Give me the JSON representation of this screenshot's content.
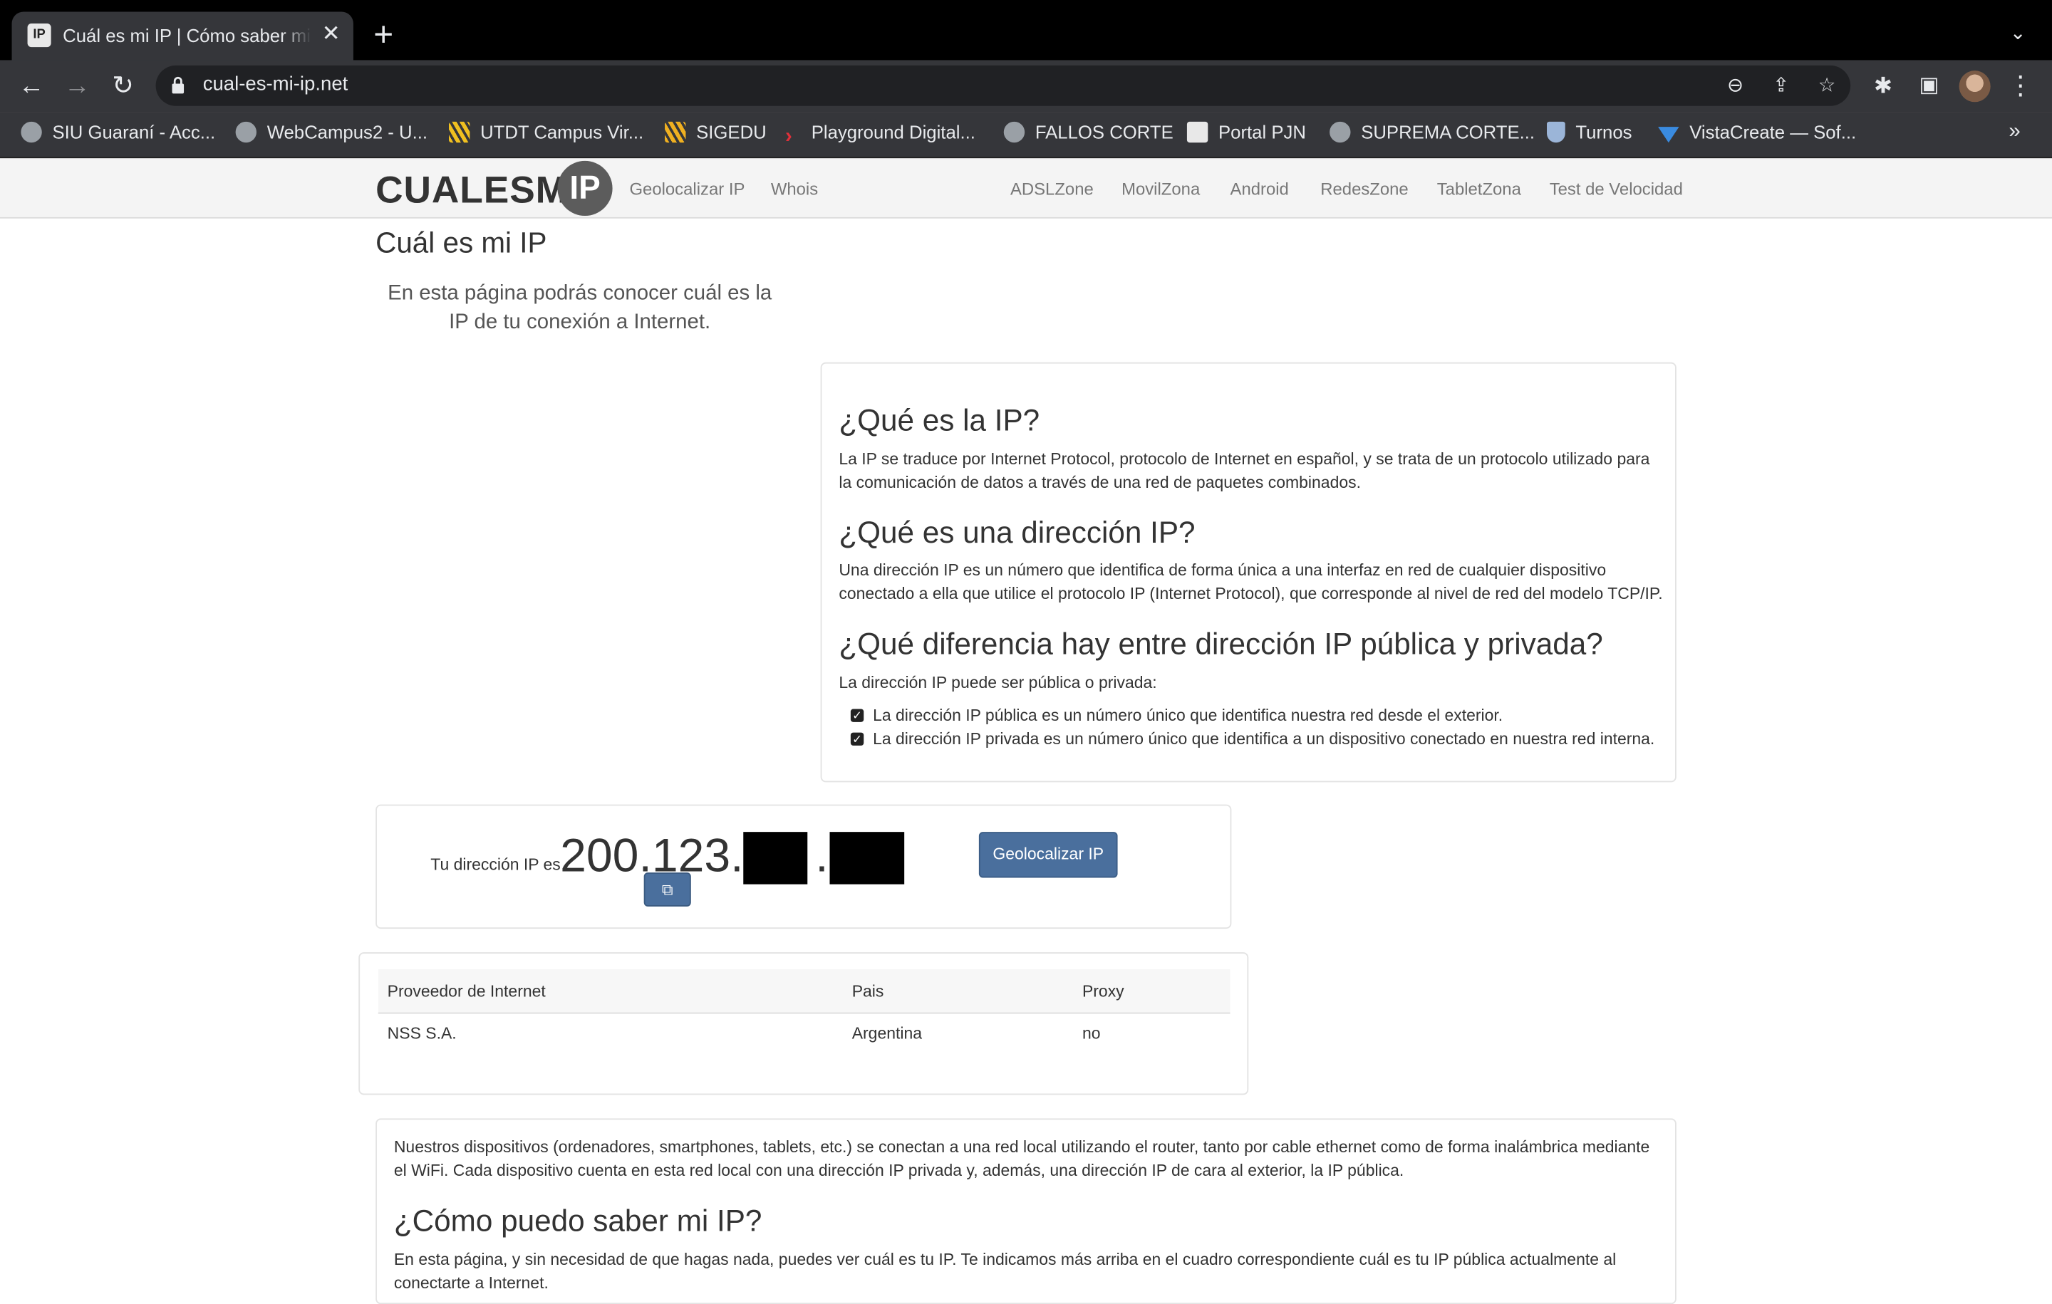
{
  "browser": {
    "tab_title": "Cuál es mi IP | Cómo saber mi IP",
    "url": "cual-es-mi-ip.net",
    "bookmarks": [
      {
        "label": "SIU Guaraní - Acc...",
        "icon": "globe-icon"
      },
      {
        "label": "WebCampus2 - U...",
        "icon": "globe-icon"
      },
      {
        "label": "UTDT Campus Vir...",
        "icon": "utdt-icon"
      },
      {
        "label": "SIGEDU",
        "icon": "sigedu-icon"
      },
      {
        "label": "Playground Digital...",
        "icon": "playground-icon"
      },
      {
        "label": "FALLOS CORTE",
        "icon": "globe-icon"
      },
      {
        "label": "Portal PJN",
        "icon": "pjn-icon"
      },
      {
        "label": "SUPREMA CORTE...",
        "icon": "globe-icon"
      },
      {
        "label": "Turnos",
        "icon": "turnos-icon"
      },
      {
        "label": "VistaCreate — Sof...",
        "icon": "vistacreate-icon"
      }
    ],
    "more_bookmarks": "»"
  },
  "site": {
    "logo_text": "CUALESMI",
    "logo_badge": "IP",
    "nav_left": [
      "Geolocalizar IP",
      "Whois"
    ],
    "nav_right": [
      "ADSLZone",
      "MovilZona",
      "Android",
      "RedesZone",
      "TabletZona",
      "Test de Velocidad"
    ]
  },
  "main": {
    "title": "Cuál es mi IP",
    "lead": "En esta página podrás conocer cuál es la IP de tu conexión a Internet.",
    "info": {
      "h1": "¿Qué es la IP?",
      "p1": "La IP se traduce por Internet Protocol, protocolo de Internet en español, y se trata de un protocolo utilizado para la comunicación de datos a través de una red de paquetes combinados.",
      "h2": "¿Qué es una dirección IP?",
      "p2": "Una dirección IP es un número que identifica de forma única a una interfaz en red de cualquier dispositivo conectado a ella que utilice el protocolo IP (Internet Protocol), que corresponde al nivel de red del modelo TCP/IP.",
      "h3": "¿Qué diferencia hay entre dirección IP pública y privada?",
      "p3": "La dirección IP puede ser pública o privada:",
      "list": [
        "La dirección IP pública es un número único que identifica nuestra red desde el exterior.",
        "La dirección IP privada es un número único que identifica a un dispositivo conectado en nuestra red interna."
      ]
    },
    "ip_box": {
      "label": "Tu dirección IP es",
      "ip_visible": "200.123.",
      "ip_dot": ".",
      "copy_icon": "copy-icon",
      "button": "Geolocalizar IP"
    },
    "table": {
      "headers": [
        "Proveedor de Internet",
        "Pais",
        "Proxy"
      ],
      "row": [
        "NSS S.A.",
        "Argentina",
        "no"
      ]
    },
    "bottom": {
      "p1": "Nuestros dispositivos (ordenadores, smartphones, tablets, etc.) se conectan a una red local utilizando el router, tanto por cable ethernet como de forma inalámbrica mediante el WiFi. Cada dispositivo cuenta en esta red local con una dirección IP privada y, además, una dirección IP de cara al exterior, la IP pública.",
      "h": "¿Cómo puedo saber mi IP?",
      "p2": "En esta página, y sin necesidad de que hagas nada, puedes ver cuál es tu IP. Te indicamos más arriba en el cuadro correspondiente cuál es tu IP pública actualmente al conectarte a Internet."
    }
  }
}
